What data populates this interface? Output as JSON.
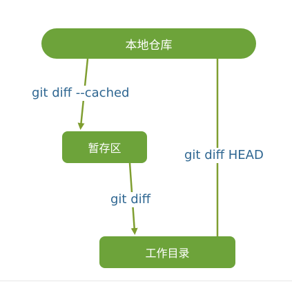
{
  "nodes": {
    "repository": "本地仓库",
    "staging": "暂存区",
    "working": "工作目录"
  },
  "edges": {
    "repo_to_staging": "git diff --cached",
    "staging_to_working": "git diff",
    "repo_to_working": "git diff HEAD"
  },
  "colors": {
    "node_fill": "#6da33a",
    "node_text": "#ffffff",
    "edge_line": "#7f9e30",
    "edge_label": "#2e6691"
  }
}
